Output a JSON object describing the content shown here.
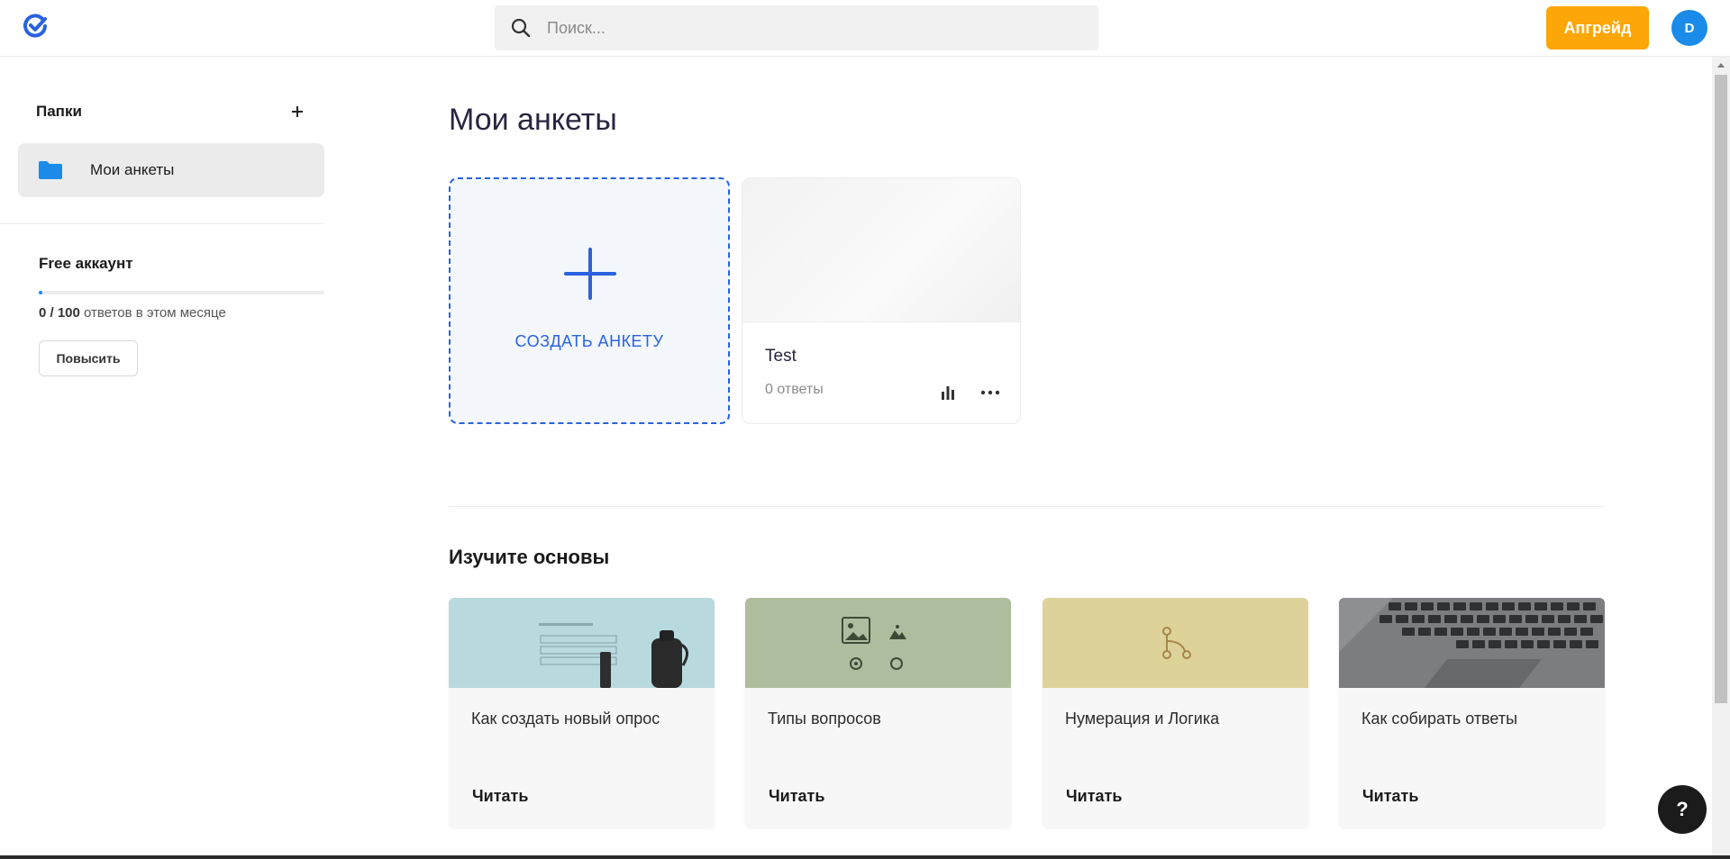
{
  "header": {
    "logo_icon": "checkmark-logo-icon",
    "search_placeholder": "Поиск...",
    "upgrade_label": "Апгрейд",
    "avatar_initial": "D"
  },
  "sidebar": {
    "folders_title": "Папки",
    "folders": [
      {
        "label": "Мои анкеты",
        "icon": "folder-icon",
        "selected": true
      }
    ],
    "account": {
      "title": "Free аккаунт",
      "used": "0",
      "limit": "100",
      "count_text": "0 / 100",
      "suffix": "ответов в этом месяце",
      "progress_fraction": 0.0,
      "raise_label": "Повысить"
    }
  },
  "main": {
    "title": "Мои анкеты",
    "create_label": "СОЗДАТЬ АНКЕТУ",
    "surveys": [
      {
        "name": "Test",
        "responses": "0 ответы"
      }
    ],
    "learn_title": "Изучите основы",
    "learn_cards": [
      {
        "title": "Как создать новый опрос",
        "read_label": "Читать"
      },
      {
        "title": "Типы вопросов",
        "read_label": "Читать"
      },
      {
        "title": "Нумерация и Логика",
        "read_label": "Читать"
      },
      {
        "title": "Как собирать ответы",
        "read_label": "Читать"
      }
    ]
  },
  "help_label": "?",
  "colors": {
    "accent": "#2a62e0",
    "upgrade": "#fda608",
    "avatar": "#1a8be8",
    "folder": "#1a8be8"
  }
}
